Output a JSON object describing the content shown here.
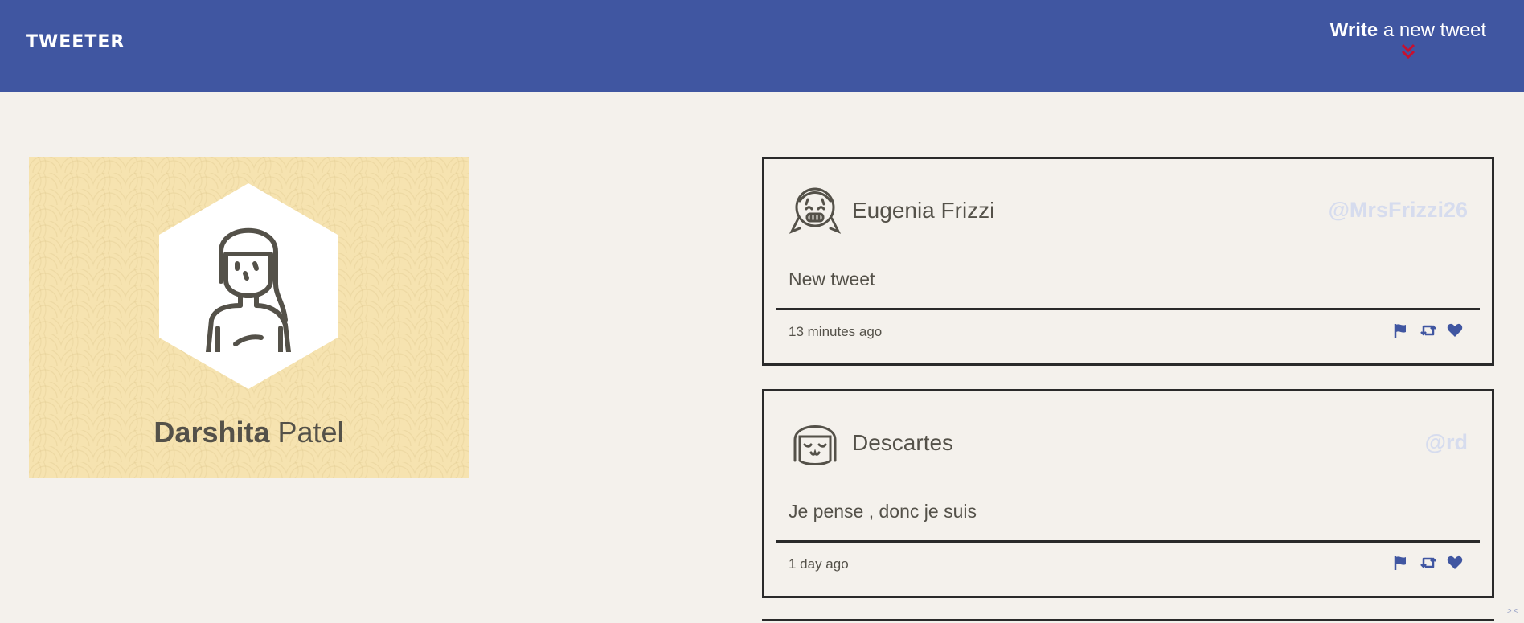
{
  "nav": {
    "brand": "TWEETER",
    "compose_bold": "Write",
    "compose_rest": " a new tweet",
    "compose_icon": "double-chevron-down-icon",
    "compose_icon_color": "#c8102e"
  },
  "profile": {
    "first_name": "Darshita",
    "last_name": "Patel",
    "avatar_icon": "girl-avatar-icon"
  },
  "tweets": [
    {
      "display_name": "Eugenia Frizzi",
      "handle": "@MrsFrizzi26",
      "content": "New tweet",
      "time": "13 minutes ago",
      "avatar_icon": "smiling-girl-avatar-icon"
    },
    {
      "display_name": "Descartes",
      "handle": "@rd",
      "content": "Je pense , donc je suis",
      "time": "1 day ago",
      "avatar_icon": "bob-hair-avatar-icon"
    }
  ],
  "actions": [
    "flag-icon",
    "retweet-icon",
    "heart-icon"
  ],
  "colors": {
    "nav_bg": "#4056a1",
    "page_bg": "#f4f1ec",
    "profile_bg": "#f6e3b0",
    "accent_icon": "#4056a1",
    "handle": "#d6dcee",
    "text": "#545149"
  }
}
